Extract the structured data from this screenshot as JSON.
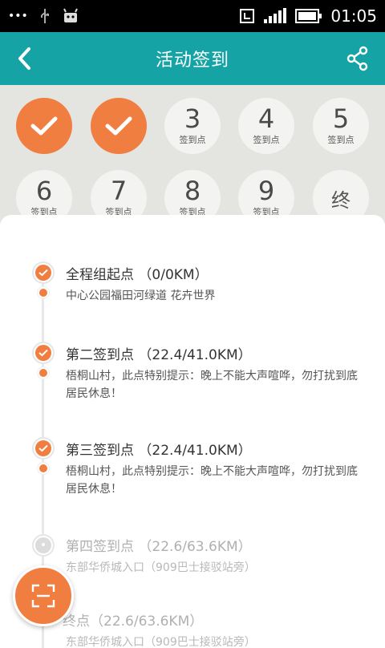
{
  "status_bar": {
    "time": "01:05",
    "left_text": "•••"
  },
  "header": {
    "title": "活动签到"
  },
  "checkpoints": [
    {
      "state": "done"
    },
    {
      "state": "done"
    },
    {
      "number": "3",
      "label": "签到点"
    },
    {
      "number": "4",
      "label": "签到点"
    },
    {
      "number": "5",
      "label": "签到点"
    },
    {
      "number": "6",
      "label": "签到点"
    },
    {
      "number": "7",
      "label": "签到点"
    },
    {
      "number": "8",
      "label": "签到点"
    },
    {
      "number": "9",
      "label": "签到点"
    },
    {
      "end": "终"
    }
  ],
  "list": [
    {
      "title": "全程组起点 （0/0KM）",
      "desc": "中心公园福田河绿道 花卉世界",
      "state": "done"
    },
    {
      "title": "第二签到点 （22.4/41.0KM）",
      "desc": "梧桐山村，此点特别提示：晚上不能大声喧哗，勿打扰到底居民休息！",
      "state": "done"
    },
    {
      "title": "第三签到点 （22.4/41.0KM）",
      "desc": "梧桐山村，此点特别提示：晚上不能大声喧哗，勿打扰到底居民休息！",
      "state": "done"
    },
    {
      "title": "第四签到点 （22.6/63.6KM）",
      "desc": "东部华侨城入口（909巴士接驳站旁）",
      "state": "pending"
    },
    {
      "title": "终点（22.6/63.6KM）",
      "desc": "东部华侨城入口（909巴士接驳站旁）",
      "state": "pending"
    }
  ],
  "colors": {
    "accent": "#f07e40",
    "header": "#16a3a6"
  }
}
